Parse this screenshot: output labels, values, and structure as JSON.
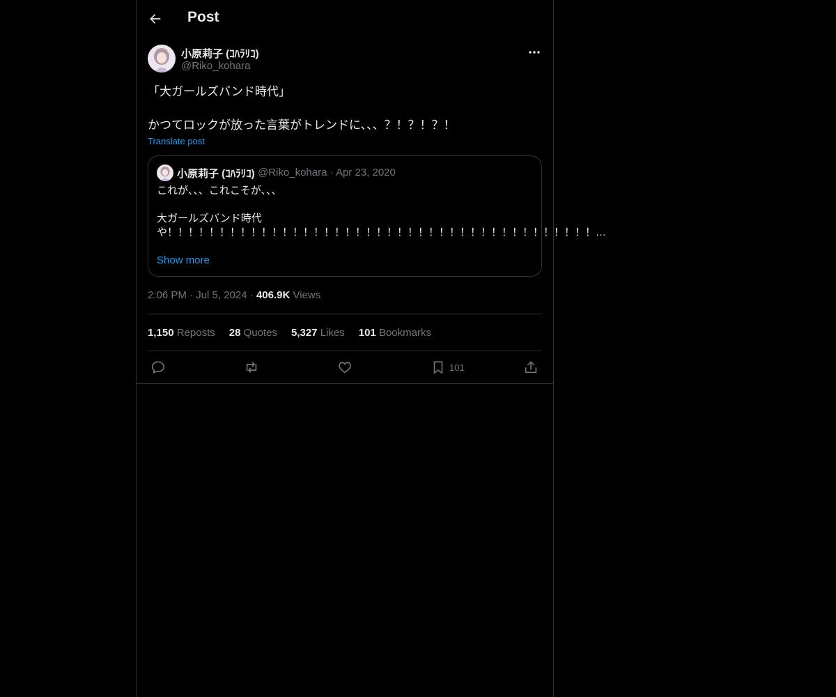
{
  "header": {
    "title": "Post"
  },
  "post": {
    "author_name": "小原莉子 (ｺﾊﾗﾘｺ)",
    "author_handle": "@Riko_kohara",
    "text": "「大ガールズバンド時代」\n\nかつてロックが放った言葉がトレンドに、、、？！？！？！",
    "translate_label": "Translate post",
    "quote": {
      "author_name": "小原莉子 (ｺﾊﾗﾘｺ)",
      "meta": "@Riko_kohara · Apr 23, 2020",
      "text": "これが、、、これこそが、、、\n\n大ガールズバンド時代\nや！！！！！！！！！！！！！！！！！！！！！！！！！！！！！！！！！！！！！！！！！…",
      "show_more": "Show more"
    },
    "time": "2:06 PM",
    "date": "Jul 5, 2024",
    "views_count": "406.9K",
    "views_label": "Views"
  },
  "stats": {
    "reposts_count": "1,150",
    "reposts_label": "Reposts",
    "quotes_count": "28",
    "quotes_label": "Quotes",
    "likes_count": "5,327",
    "likes_label": "Likes",
    "bookmarks_count": "101",
    "bookmarks_label": "Bookmarks"
  },
  "actions": {
    "bookmark_count": "101"
  },
  "icons": {
    "back": "arrow-left-icon",
    "more": "more-horizontal-icon",
    "reply": "reply-icon",
    "repost": "repost-icon",
    "like": "heart-icon",
    "bookmark": "bookmark-icon",
    "share": "share-icon"
  },
  "colors": {
    "background": "#000000",
    "text": "#e7e9ea",
    "secondary": "#71767b",
    "accent": "#1d9bf0",
    "border": "#2f3336"
  }
}
